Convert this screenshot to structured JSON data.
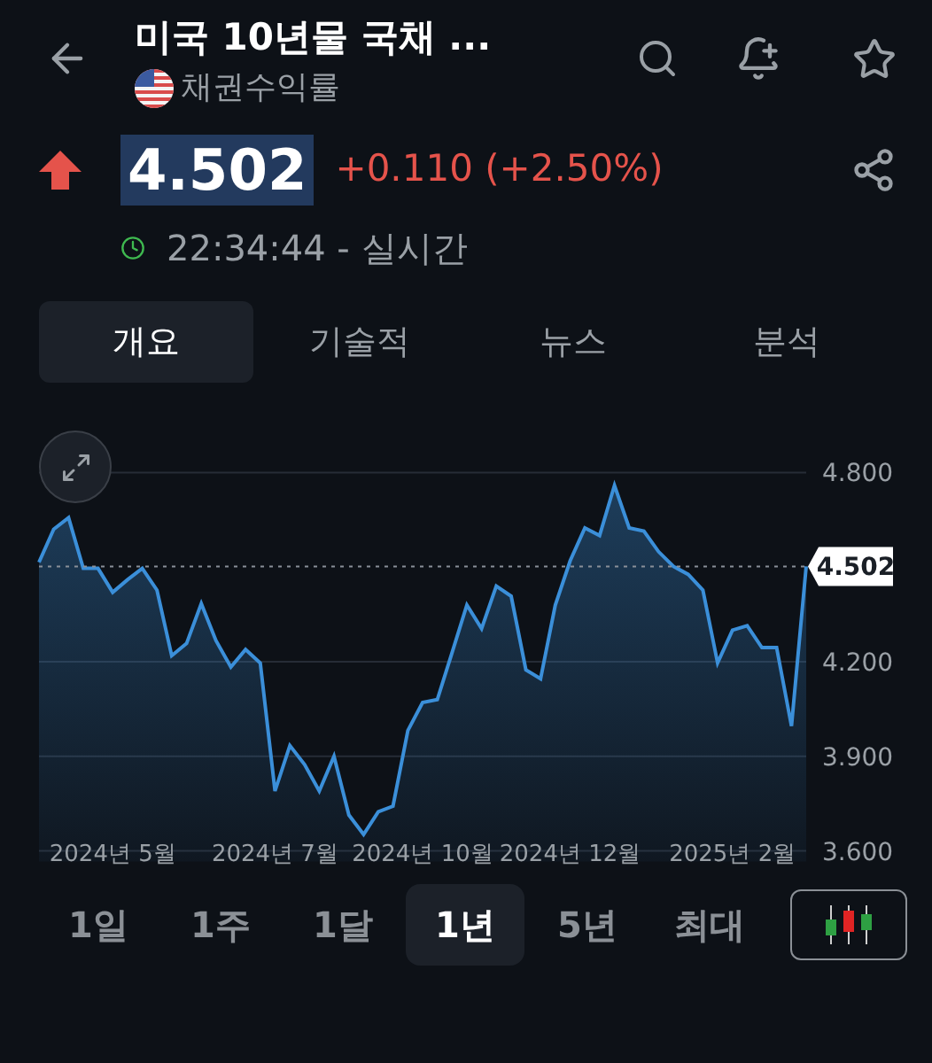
{
  "header": {
    "title": "미국 10년물 국채 ...",
    "subtitle": "채권수익률"
  },
  "quote": {
    "rising": true,
    "price": "4.502",
    "change": "+0.110 (+2.50%)",
    "time": "22:34:44 - 실시간"
  },
  "tabs": [
    {
      "label": "개요",
      "selected": true
    },
    {
      "label": "기술적",
      "selected": false
    },
    {
      "label": "뉴스",
      "selected": false
    },
    {
      "label": "분석",
      "selected": false
    }
  ],
  "chart": {
    "price_tag": "4.502",
    "chart_data": {
      "type": "area",
      "categories": [
        null,
        null,
        null,
        null,
        null,
        "2024년 5월",
        null,
        null,
        null,
        null,
        null,
        null,
        null,
        null,
        null,
        null,
        "2024년 7월",
        null,
        null,
        null,
        null,
        null,
        null,
        null,
        null,
        null,
        "2024년 10월",
        null,
        null,
        null,
        null,
        null,
        null,
        null,
        null,
        null,
        "2024년 12월",
        null,
        null,
        null,
        null,
        null,
        null,
        null,
        null,
        null,
        null,
        "2025년 2월",
        null,
        null,
        null,
        null,
        null
      ],
      "series": [
        {
          "color": "#3b8fd9",
          "values": [
            4.515,
            4.62,
            4.657,
            4.496,
            4.496,
            4.42,
            4.46,
            4.496,
            4.427,
            4.219,
            4.258,
            4.384,
            4.267,
            4.183,
            4.239,
            4.196,
            3.79,
            3.934,
            3.874,
            3.79,
            3.9,
            3.714,
            3.652,
            3.724,
            3.742,
            3.982,
            4.071,
            4.08,
            4.23,
            4.38,
            4.305,
            4.44,
            4.408,
            4.174,
            4.146,
            4.38,
            4.52,
            4.624,
            4.6,
            4.759,
            4.624,
            4.614,
            4.549,
            4.502,
            4.477,
            4.427,
            4.196,
            4.3,
            4.314,
            4.245,
            4.245,
            3.996,
            4.502
          ]
        }
      ],
      "grid": true,
      "ylim": [
        3.6,
        4.8
      ],
      "yticks": [
        {
          "value": 3.6,
          "label": "3.600"
        },
        {
          "value": 3.9,
          "label": "3.900"
        },
        {
          "value": 4.2,
          "label": "4.200"
        },
        {
          "value": 4.8,
          "label": "4.800"
        }
      ]
    }
  },
  "ranges": [
    {
      "label": "1일",
      "selected": false
    },
    {
      "label": "1주",
      "selected": false
    },
    {
      "label": "1달",
      "selected": false
    },
    {
      "label": "1년",
      "selected": true
    },
    {
      "label": "5년",
      "selected": false
    },
    {
      "label": "최대",
      "selected": false
    }
  ]
}
